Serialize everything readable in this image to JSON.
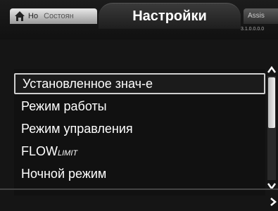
{
  "tabs": {
    "left": {
      "label_1": "Но",
      "label_2": "Состоян"
    },
    "center": {
      "title": "Настройки"
    },
    "right": {
      "label": "Assis",
      "version": "3.1.0.0.0.0"
    }
  },
  "menu": {
    "items": [
      {
        "label": "Установленное знач-е",
        "selected": true
      },
      {
        "label": "Режим работы",
        "selected": false
      },
      {
        "label": "Режим управления",
        "selected": false
      },
      {
        "label_main": "FLOW",
        "label_suffix": "LIMIT",
        "selected": false
      },
      {
        "label": "Ночной режим",
        "selected": false
      }
    ]
  },
  "icons": {
    "home": "home-icon",
    "scroll_up": "chevron-up-icon",
    "scroll_down": "chevron-down-icon",
    "next": "chevron-right-icon"
  },
  "colors": {
    "background": "#151515",
    "selection_border": "#cfcfcf",
    "text": "#ffffff"
  }
}
